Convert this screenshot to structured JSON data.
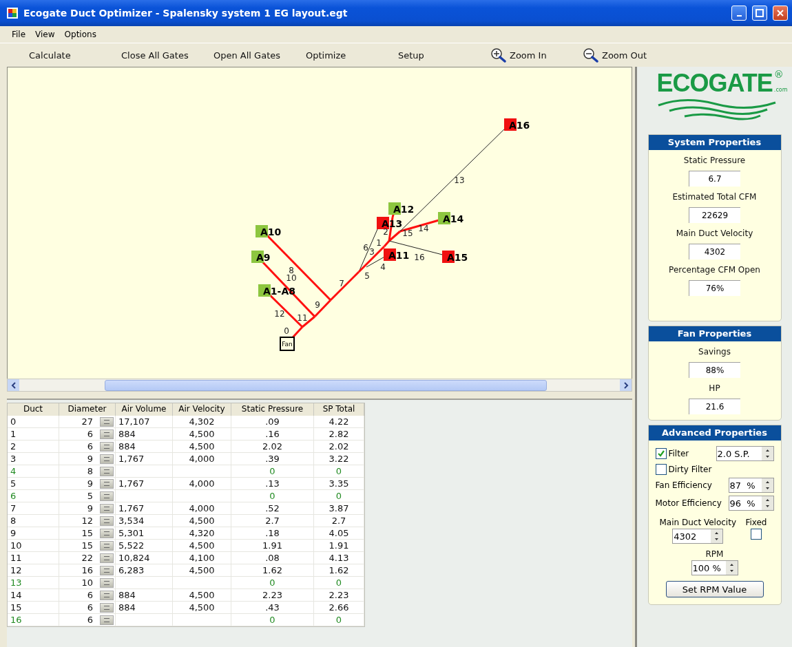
{
  "window": {
    "title": "Ecogate Duct Optimizer - Spalensky system 1 EG layout.egt"
  },
  "menu": [
    "File",
    "View",
    "Options"
  ],
  "toolbar": [
    {
      "label": "Calculate",
      "kind": "text"
    },
    {
      "label": "Close All Gates",
      "kind": "text"
    },
    {
      "label": "Open All Gates",
      "kind": "text"
    },
    {
      "label": "Optimize",
      "kind": "text"
    },
    {
      "label": "Setup",
      "kind": "text"
    },
    {
      "label": "Zoom In",
      "kind": "zoom_in"
    },
    {
      "label": "Zoom Out",
      "kind": "zoom_out"
    }
  ],
  "diagram": {
    "fan": "Fan",
    "gates": [
      {
        "label": "A16",
        "open": false
      },
      {
        "label": "A12",
        "open": true
      },
      {
        "label": "A13",
        "open": false
      },
      {
        "label": "A14",
        "open": true
      },
      {
        "label": "A10",
        "open": true
      },
      {
        "label": "A9",
        "open": true
      },
      {
        "label": "A11",
        "open": false
      },
      {
        "label": "A15",
        "open": false
      },
      {
        "label": "A1-A8",
        "open": true
      }
    ],
    "ducts": [
      {
        "label": "0",
        "open": true
      },
      {
        "label": "12",
        "open": true
      },
      {
        "label": "11",
        "open": true
      },
      {
        "label": "10",
        "open": true
      },
      {
        "label": "9",
        "open": true
      },
      {
        "label": "8",
        "open": true
      },
      {
        "label": "7",
        "open": true
      },
      {
        "label": "6",
        "open": false
      },
      {
        "label": "5",
        "open": true
      },
      {
        "label": "4",
        "open": false
      },
      {
        "label": "3",
        "open": true
      },
      {
        "label": "1",
        "open": true
      },
      {
        "label": "2",
        "open": true
      },
      {
        "label": "15",
        "open": true
      },
      {
        "label": "14",
        "open": true
      },
      {
        "label": "13",
        "open": false
      },
      {
        "label": "16",
        "open": false
      }
    ]
  },
  "table": {
    "columns": [
      "Duct",
      "Diameter",
      "Air Volume",
      "Air Velocity",
      "Static Pressure",
      "SP Total"
    ],
    "rows": [
      {
        "cells": [
          "0",
          "27",
          "17,107",
          "4,302",
          ".09",
          "4.22"
        ],
        "open": true
      },
      {
        "cells": [
          "1",
          "6",
          "884",
          "4,500",
          ".16",
          "2.82"
        ],
        "open": true
      },
      {
        "cells": [
          "2",
          "6",
          "884",
          "4,500",
          "2.02",
          "2.02"
        ],
        "open": true
      },
      {
        "cells": [
          "3",
          "9",
          "1,767",
          "4,000",
          ".39",
          "3.22"
        ],
        "open": true
      },
      {
        "cells": [
          "4",
          "8",
          "",
          "",
          "0",
          "0"
        ],
        "open": false
      },
      {
        "cells": [
          "5",
          "9",
          "1,767",
          "4,000",
          ".13",
          "3.35"
        ],
        "open": true
      },
      {
        "cells": [
          "6",
          "5",
          "",
          "",
          "0",
          "0"
        ],
        "open": false
      },
      {
        "cells": [
          "7",
          "9",
          "1,767",
          "4,000",
          ".52",
          "3.87"
        ],
        "open": true
      },
      {
        "cells": [
          "8",
          "12",
          "3,534",
          "4,500",
          "2.7",
          "2.7"
        ],
        "open": true
      },
      {
        "cells": [
          "9",
          "15",
          "5,301",
          "4,320",
          ".18",
          "4.05"
        ],
        "open": true
      },
      {
        "cells": [
          "10",
          "15",
          "5,522",
          "4,500",
          "1.91",
          "1.91"
        ],
        "open": true
      },
      {
        "cells": [
          "11",
          "22",
          "10,824",
          "4,100",
          ".08",
          "4.13"
        ],
        "open": true
      },
      {
        "cells": [
          "12",
          "16",
          "6,283",
          "4,500",
          "1.62",
          "1.62"
        ],
        "open": true
      },
      {
        "cells": [
          "13",
          "10",
          "",
          "",
          "0",
          "0"
        ],
        "open": false
      },
      {
        "cells": [
          "14",
          "6",
          "884",
          "4,500",
          "2.23",
          "2.23"
        ],
        "open": true
      },
      {
        "cells": [
          "15",
          "6",
          "884",
          "4,500",
          ".43",
          "2.66"
        ],
        "open": true
      },
      {
        "cells": [
          "16",
          "6",
          "",
          "",
          "0",
          "0"
        ],
        "open": false
      }
    ]
  },
  "logo": {
    "name": "ECOGATE",
    "mark": "®",
    "suffix": ".com"
  },
  "system_properties": {
    "title": "System Properties",
    "fields": [
      {
        "label": "Static Pressure",
        "value": "6.7"
      },
      {
        "label": "Estimated Total CFM",
        "value": "22629"
      },
      {
        "label": "Main Duct Velocity",
        "value": "4302"
      },
      {
        "label": "Percentage CFM Open",
        "value": "76%"
      }
    ]
  },
  "fan_properties": {
    "title": "Fan Properties",
    "fields": [
      {
        "label": "Savings",
        "value": "88%"
      },
      {
        "label": "HP",
        "value": "21.6"
      }
    ]
  },
  "advanced_properties": {
    "title": "Advanced Properties",
    "filter": {
      "label": "Filter",
      "checked": true,
      "value": "2.0 S.P."
    },
    "dirty_filter": {
      "label": "Dirty Filter",
      "checked": false
    },
    "fan_efficiency": {
      "label": "Fan Efficiency",
      "value": "87  %"
    },
    "motor_efficiency": {
      "label": "Motor Efficiency",
      "value": "96  %"
    },
    "main_duct_velocity": {
      "label": "Main Duct Velocity",
      "value": "4302"
    },
    "fixed": {
      "label": "Fixed",
      "checked": false
    },
    "rpm": {
      "label": "RPM",
      "value": "100 %"
    },
    "button": "Set RPM Value"
  }
}
